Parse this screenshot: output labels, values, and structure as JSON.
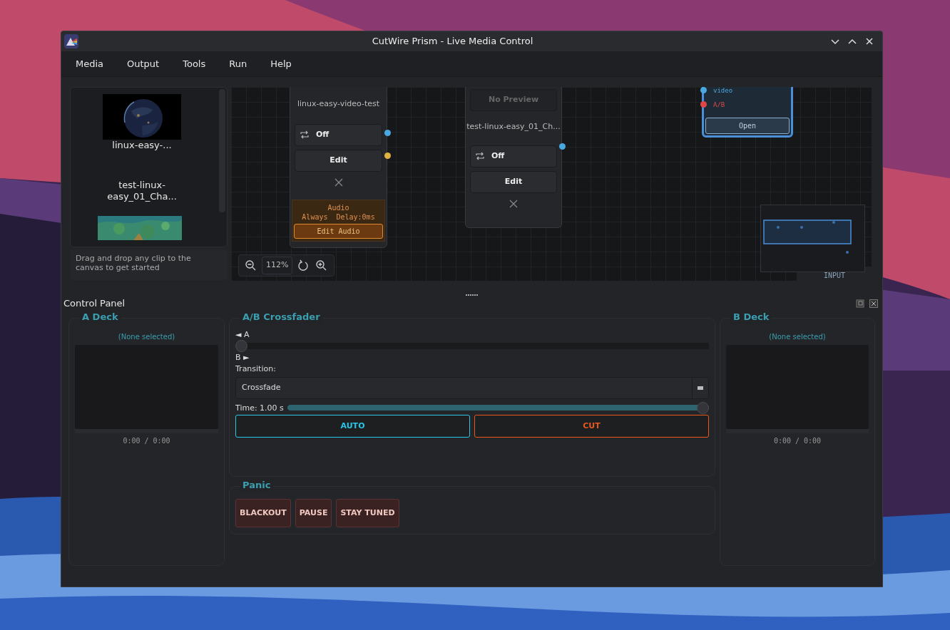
{
  "window": {
    "title": "CutWire Prism - Live Media Control"
  },
  "menu": [
    {
      "label": "Media"
    },
    {
      "label": "Output"
    },
    {
      "label": "Tools"
    },
    {
      "label": "Run"
    },
    {
      "label": "Help"
    }
  ],
  "library": {
    "items": [
      {
        "kind": "clip",
        "label": "linux-easy-..."
      },
      {
        "kind": "text",
        "label": "test-linux-easy_01_Cha..."
      },
      {
        "kind": "clip"
      }
    ],
    "hint": "Drag and drop any clip to the canvas to get started"
  },
  "canvas": {
    "nodes": [
      {
        "kind": "media",
        "name": "linux-easy-video-test",
        "loop": "Off",
        "edit": "Edit",
        "ports": [
          {
            "color": "#4aa8e0"
          },
          {
            "color": "#e0b040"
          }
        ],
        "audio": {
          "title": "Audio",
          "mode": "Always",
          "delay": "Delay:0ms",
          "button": "Edit Audio"
        }
      },
      {
        "kind": "media",
        "preview_text": "No Preview",
        "name": "test-linux-easy_01_Ch...",
        "loop": "Off",
        "edit": "Edit",
        "ports": [
          {
            "color": "#4aa8e0"
          }
        ]
      },
      {
        "kind": "output",
        "ports": [
          {
            "label": "video",
            "color": "#4aa8e0"
          },
          {
            "label": "A/B",
            "color": "#e04848"
          }
        ],
        "button": "Open"
      }
    ],
    "zoom": "112%",
    "minimap_label": "INPUT"
  },
  "control_panel": {
    "title": "Control Panel",
    "decks": [
      {
        "title": "A Deck",
        "clip": "(None selected)",
        "time": "0:00 / 0:00"
      },
      {
        "title": "B Deck",
        "clip": "(None selected)",
        "time": "0:00 / 0:00"
      }
    ],
    "crossfader": {
      "title": "A/B Crossfader",
      "a_label": "◄ A",
      "fader": {
        "level": 0
      },
      "b_label": "B ►",
      "transition_label": "Transition:",
      "transition": "Crossfade",
      "time": {
        "label": "Time: 1.00 s",
        "level": 1
      },
      "buttons": [
        {
          "kind": "auto",
          "label": "AUTO"
        },
        {
          "kind": "cut",
          "label": "CUT"
        }
      ]
    },
    "panic": {
      "title": "Panic",
      "buttons": [
        {
          "label": "BLACKOUT"
        },
        {
          "label": "PAUSE"
        },
        {
          "label": "STAY TUNED"
        }
      ]
    }
  }
}
